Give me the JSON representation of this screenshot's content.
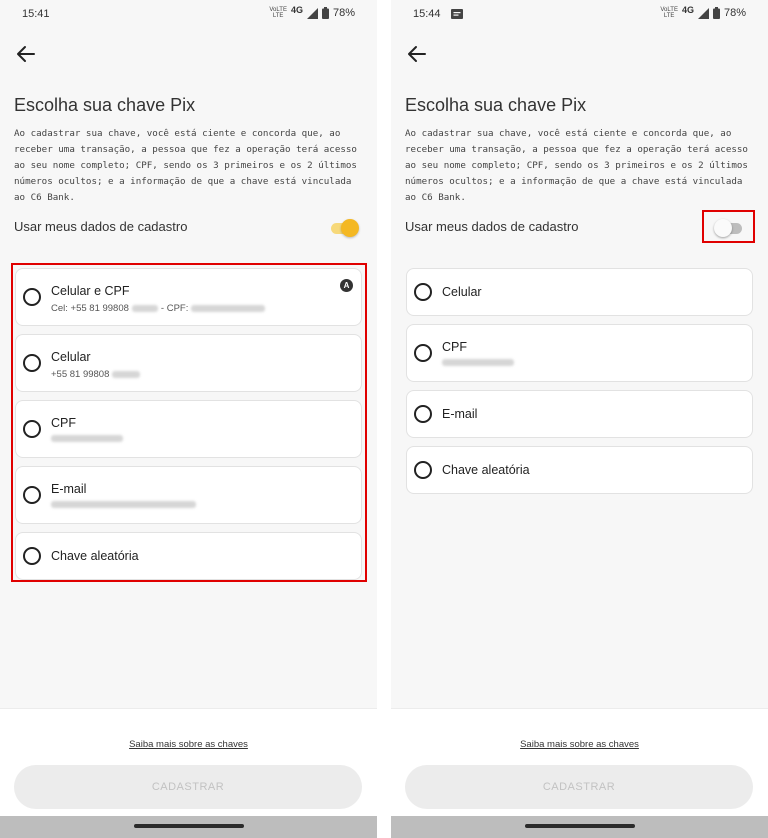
{
  "left": {
    "status": {
      "time": "15:41",
      "carrier_top": "VoLTE",
      "carrier_bottom": "LTE",
      "network": "4G",
      "battery": "78%"
    },
    "title": "Escolha sua chave Pix",
    "disclaimer": "Ao cadastrar sua chave, você está ciente e concorda que, ao receber uma transação, a pessoa que fez a operação terá acesso ao seu nome completo; CPF, sendo os 3 primeiros e os 2 últimos números ocultos; e a informação de que a chave está vinculada ao C6 Bank.",
    "toggle": {
      "label": "Usar meus dados de cadastro",
      "state": "on"
    },
    "options": [
      {
        "title": "Celular e CPF",
        "sub_prefix": "Cel: +55 81 99808",
        "sub_middle": " - CPF:",
        "badge": "A"
      },
      {
        "title": "Celular",
        "sub_prefix": "+55 81 99808"
      },
      {
        "title": "CPF"
      },
      {
        "title": "E-mail"
      },
      {
        "title": "Chave aleatória"
      }
    ],
    "footer": {
      "learn_more": "Saiba mais sobre as chaves",
      "register": "CADASTRAR"
    }
  },
  "right": {
    "status": {
      "time": "15:44",
      "carrier_top": "VoLTE",
      "carrier_bottom": "LTE",
      "network": "4G",
      "battery": "78%"
    },
    "title": "Escolha sua chave Pix",
    "disclaimer": "Ao cadastrar sua chave, você está ciente e concorda que, ao receber uma transação, a pessoa que fez a operação terá acesso ao seu nome completo; CPF, sendo os 3 primeiros e os 2 últimos números ocultos; e a informação de que a chave está vinculada ao C6 Bank.",
    "toggle": {
      "label": "Usar meus dados de cadastro",
      "state": "off"
    },
    "options": [
      {
        "title": "Celular"
      },
      {
        "title": "CPF"
      },
      {
        "title": "E-mail"
      },
      {
        "title": "Chave aleatória"
      }
    ],
    "footer": {
      "learn_more": "Saiba mais sobre as chaves",
      "register": "CADASTRAR"
    }
  },
  "colors": {
    "toggle_on": "#f4b823",
    "highlight": "#e00000",
    "button_disabled": "#ececec"
  },
  "icons": {
    "back": "arrow-left-icon",
    "radio": "radio-unselected-icon",
    "signal": "signal-icon",
    "battery": "battery-icon",
    "message": "message-icon"
  }
}
